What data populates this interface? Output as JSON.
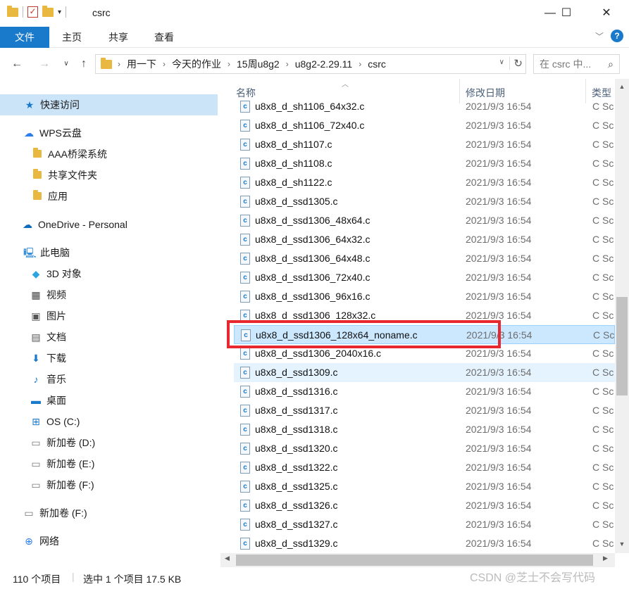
{
  "window": {
    "title": "csrc",
    "minimize": "—",
    "maximize": "☐",
    "close": "✕"
  },
  "ribbon": {
    "tabs": [
      "文件",
      "主页",
      "共享",
      "查看"
    ]
  },
  "address": {
    "crumbs": [
      "用一下",
      "今天的作业",
      "15周u8g2",
      "u8g2-2.29.11",
      "csrc"
    ],
    "search_placeholder": "在 csrc 中..."
  },
  "sidebar": {
    "quick_access": "快速访问",
    "wps": "WPS云盘",
    "wps_children": [
      "AAA桥梁系统",
      "共享文件夹",
      "应用"
    ],
    "onedrive": "OneDrive - Personal",
    "this_pc": "此电脑",
    "pc_children": [
      "3D 对象",
      "视频",
      "图片",
      "文档",
      "下载",
      "音乐",
      "桌面",
      "OS (C:)",
      "新加卷 (D:)",
      "新加卷 (E:)",
      "新加卷 (F:)"
    ],
    "drive_f": "新加卷 (F:)",
    "network": "网络"
  },
  "columns": {
    "name": "名称",
    "date": "修改日期",
    "type": "类型"
  },
  "files": [
    {
      "name": "u8x8_d_sh1106_64x32.c",
      "date": "2021/9/3 16:54",
      "type": "C Sc"
    },
    {
      "name": "u8x8_d_sh1106_72x40.c",
      "date": "2021/9/3 16:54",
      "type": "C Sc"
    },
    {
      "name": "u8x8_d_sh1107.c",
      "date": "2021/9/3 16:54",
      "type": "C Sc"
    },
    {
      "name": "u8x8_d_sh1108.c",
      "date": "2021/9/3 16:54",
      "type": "C Sc"
    },
    {
      "name": "u8x8_d_sh1122.c",
      "date": "2021/9/3 16:54",
      "type": "C Sc"
    },
    {
      "name": "u8x8_d_ssd1305.c",
      "date": "2021/9/3 16:54",
      "type": "C Sc"
    },
    {
      "name": "u8x8_d_ssd1306_48x64.c",
      "date": "2021/9/3 16:54",
      "type": "C Sc"
    },
    {
      "name": "u8x8_d_ssd1306_64x32.c",
      "date": "2021/9/3 16:54",
      "type": "C Sc"
    },
    {
      "name": "u8x8_d_ssd1306_64x48.c",
      "date": "2021/9/3 16:54",
      "type": "C Sc"
    },
    {
      "name": "u8x8_d_ssd1306_72x40.c",
      "date": "2021/9/3 16:54",
      "type": "C Sc"
    },
    {
      "name": "u8x8_d_ssd1306_96x16.c",
      "date": "2021/9/3 16:54",
      "type": "C Sc"
    },
    {
      "name": "u8x8_d_ssd1306_128x32.c",
      "date": "2021/9/3 16:54",
      "type": "C Sc"
    },
    {
      "name": "u8x8_d_ssd1306_128x64_noname.c",
      "date": "2021/9/3 16:54",
      "type": "C Sc"
    },
    {
      "name": "u8x8_d_ssd1306_2040x16.c",
      "date": "2021/9/3 16:54",
      "type": "C Sc"
    },
    {
      "name": "u8x8_d_ssd1309.c",
      "date": "2021/9/3 16:54",
      "type": "C Sc"
    },
    {
      "name": "u8x8_d_ssd1316.c",
      "date": "2021/9/3 16:54",
      "type": "C Sc"
    },
    {
      "name": "u8x8_d_ssd1317.c",
      "date": "2021/9/3 16:54",
      "type": "C Sc"
    },
    {
      "name": "u8x8_d_ssd1318.c",
      "date": "2021/9/3 16:54",
      "type": "C Sc"
    },
    {
      "name": "u8x8_d_ssd1320.c",
      "date": "2021/9/3 16:54",
      "type": "C Sc"
    },
    {
      "name": "u8x8_d_ssd1322.c",
      "date": "2021/9/3 16:54",
      "type": "C Sc"
    },
    {
      "name": "u8x8_d_ssd1325.c",
      "date": "2021/9/3 16:54",
      "type": "C Sc"
    },
    {
      "name": "u8x8_d_ssd1326.c",
      "date": "2021/9/3 16:54",
      "type": "C Sc"
    },
    {
      "name": "u8x8_d_ssd1327.c",
      "date": "2021/9/3 16:54",
      "type": "C Sc"
    },
    {
      "name": "u8x8_d_ssd1329.c",
      "date": "2021/9/3 16:54",
      "type": "C Sc"
    }
  ],
  "selected_file": "u8x8_d_ssd1306_128x64_noname.c",
  "hover_file": "u8x8_d_ssd1309.c",
  "status": {
    "count": "110 个项目",
    "selection": "选中 1 个项目 17.5 KB"
  },
  "watermark": "CSDN @芝士不会写代码",
  "colors": {
    "accent": "#1979ca",
    "selection": "#cce8ff",
    "highlight_box": "#e8282f"
  }
}
